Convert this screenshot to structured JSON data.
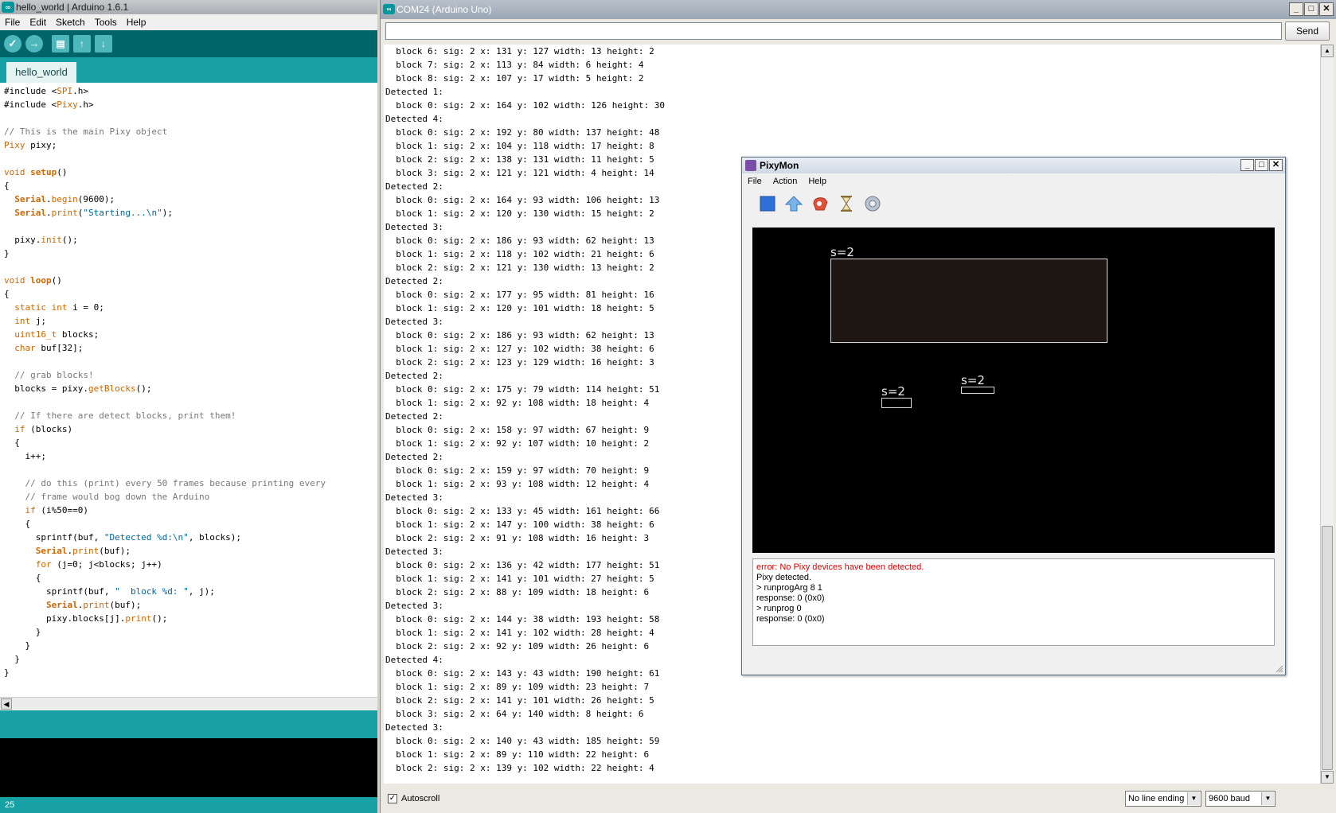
{
  "ide": {
    "title": "hello_world | Arduino 1.6.1",
    "menu": [
      "File",
      "Edit",
      "Sketch",
      "Tools",
      "Help"
    ],
    "tab": "hello_world",
    "code": [
      "#include <SPI.h>",
      "#include <Pixy.h>",
      "",
      "// This is the main Pixy object",
      "Pixy pixy;",
      "",
      "void setup()",
      "{",
      "  Serial.begin(9600);",
      "  Serial.print(\"Starting...\\n\");",
      "",
      "  pixy.init();",
      "}",
      "",
      "void loop()",
      "{",
      "  static int i = 0;",
      "  int j;",
      "  uint16_t blocks;",
      "  char buf[32];",
      "",
      "  // grab blocks!",
      "  blocks = pixy.getBlocks();",
      "",
      "  // If there are detect blocks, print them!",
      "  if (blocks)",
      "  {",
      "    i++;",
      "",
      "    // do this (print) every 50 frames because printing every",
      "    // frame would bog down the Arduino",
      "    if (i%50==0)",
      "    {",
      "      sprintf(buf, \"Detected %d:\\n\", blocks);",
      "      Serial.print(buf);",
      "      for (j=0; j<blocks; j++)",
      "      {",
      "        sprintf(buf, \"  block %d: \", j);",
      "        Serial.print(buf);",
      "        pixy.blocks[j].print();",
      "      }",
      "    }",
      "  }",
      "}"
    ],
    "line_number": "25"
  },
  "serial": {
    "title": "COM24 (Arduino Uno)",
    "input_value": "",
    "send_label": "Send",
    "output": [
      "  block 6: sig: 2 x: 131 y: 127 width: 13 height: 2",
      "  block 7: sig: 2 x: 113 y: 84 width: 6 height: 4",
      "  block 8: sig: 2 x: 107 y: 17 width: 5 height: 2",
      "Detected 1:",
      "  block 0: sig: 2 x: 164 y: 102 width: 126 height: 30",
      "Detected 4:",
      "  block 0: sig: 2 x: 192 y: 80 width: 137 height: 48",
      "  block 1: sig: 2 x: 104 y: 118 width: 17 height: 8",
      "  block 2: sig: 2 x: 138 y: 131 width: 11 height: 5",
      "  block 3: sig: 2 x: 121 y: 121 width: 4 height: 14",
      "Detected 2:",
      "  block 0: sig: 2 x: 164 y: 93 width: 106 height: 13",
      "  block 1: sig: 2 x: 120 y: 130 width: 15 height: 2",
      "Detected 3:",
      "  block 0: sig: 2 x: 186 y: 93 width: 62 height: 13",
      "  block 1: sig: 2 x: 118 y: 102 width: 21 height: 6",
      "  block 2: sig: 2 x: 121 y: 130 width: 13 height: 2",
      "Detected 2:",
      "  block 0: sig: 2 x: 177 y: 95 width: 81 height: 16",
      "  block 1: sig: 2 x: 120 y: 101 width: 18 height: 5",
      "Detected 3:",
      "  block 0: sig: 2 x: 186 y: 93 width: 62 height: 13",
      "  block 1: sig: 2 x: 127 y: 102 width: 38 height: 6",
      "  block 2: sig: 2 x: 123 y: 129 width: 16 height: 3",
      "Detected 2:",
      "  block 0: sig: 2 x: 175 y: 79 width: 114 height: 51",
      "  block 1: sig: 2 x: 92 y: 108 width: 18 height: 4",
      "Detected 2:",
      "  block 0: sig: 2 x: 158 y: 97 width: 67 height: 9",
      "  block 1: sig: 2 x: 92 y: 107 width: 10 height: 2",
      "Detected 2:",
      "  block 0: sig: 2 x: 159 y: 97 width: 70 height: 9",
      "  block 1: sig: 2 x: 93 y: 108 width: 12 height: 4",
      "Detected 3:",
      "  block 0: sig: 2 x: 133 y: 45 width: 161 height: 66",
      "  block 1: sig: 2 x: 147 y: 100 width: 38 height: 6",
      "  block 2: sig: 2 x: 91 y: 108 width: 16 height: 3",
      "Detected 3:",
      "  block 0: sig: 2 x: 136 y: 42 width: 177 height: 51",
      "  block 1: sig: 2 x: 141 y: 101 width: 27 height: 5",
      "  block 2: sig: 2 x: 88 y: 109 width: 18 height: 6",
      "Detected 3:",
      "  block 0: sig: 2 x: 144 y: 38 width: 193 height: 58",
      "  block 1: sig: 2 x: 141 y: 102 width: 28 height: 4",
      "  block 2: sig: 2 x: 92 y: 109 width: 26 height: 6",
      "Detected 4:",
      "  block 0: sig: 2 x: 143 y: 43 width: 190 height: 61",
      "  block 1: sig: 2 x: 89 y: 109 width: 23 height: 7",
      "  block 2: sig: 2 x: 141 y: 101 width: 26 height: 5",
      "  block 3: sig: 2 x: 64 y: 140 width: 8 height: 6",
      "Detected 3:",
      "  block 0: sig: 2 x: 140 y: 43 width: 185 height: 59",
      "  block 1: sig: 2 x: 89 y: 110 width: 22 height: 6",
      "  block 2: sig: 2 x: 139 y: 102 width: 22 height: 4"
    ],
    "autoscroll_label": "Autoscroll",
    "autoscroll_checked": true,
    "line_ending": "No line ending",
    "baud": "9600 baud"
  },
  "pixymon": {
    "title": "PixyMon",
    "menu": [
      "File",
      "Action",
      "Help"
    ],
    "tools": [
      "stop-icon",
      "upload-icon",
      "signature-icon",
      "hourglass-icon",
      "settings-icon"
    ],
    "block_label": "s=2",
    "console": [
      {
        "text": "error: No Pixy devices have been detected.",
        "error": true
      },
      {
        "text": "Pixy detected.",
        "error": false
      },
      {
        "text": "> runprogArg 8 1",
        "error": false
      },
      {
        "text": "response: 0 (0x0)",
        "error": false
      },
      {
        "text": "> runprog 0",
        "error": false
      },
      {
        "text": "response: 0 (0x0)",
        "error": false
      }
    ]
  },
  "colors": {
    "arduino_teal": "#00979c",
    "arduino_dark_teal": "#006468",
    "error_red": "#e00000"
  }
}
